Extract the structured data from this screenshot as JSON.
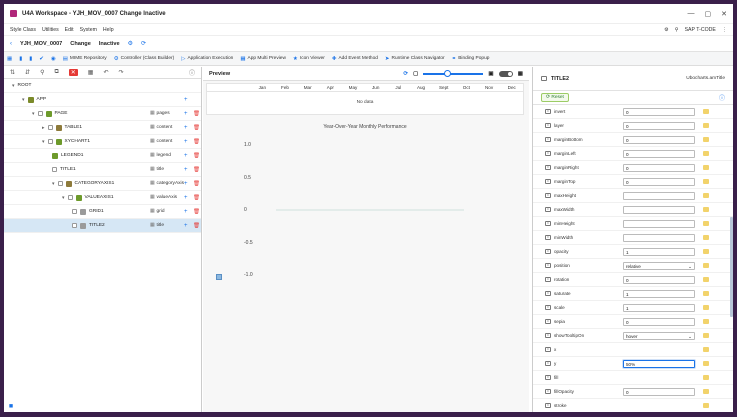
{
  "window": {
    "title": "U4A Workspace - YJH_MOV_0007 Change Inactive",
    "minimize": "—",
    "maximize": "▢",
    "close": "✕"
  },
  "menu": {
    "items": [
      "Style Class",
      "Utilities",
      "Edit",
      "System",
      "Help"
    ],
    "sap_code": "SAP T-CODE"
  },
  "header": {
    "program": "YJH_MOV_0007",
    "mode": "Change",
    "status": "Inactive"
  },
  "toolbar": {
    "items": [
      "MIME Repository",
      "Controller (Class Builder)",
      "Application Execution",
      "App Multi Preview",
      "Icon Viewer",
      "Add Event Method",
      "Runtime Class Navigator",
      "Binding Popup"
    ]
  },
  "tree": {
    "rows": [
      {
        "name": "ROOT",
        "type": "",
        "indent": 0,
        "arrow": "▾",
        "color": "",
        "check": false,
        "selected": false
      },
      {
        "name": "APP",
        "type": "",
        "indent": 1,
        "arrow": "▾",
        "color": "#7b8a2a",
        "check": false,
        "selected": false
      },
      {
        "name": "PAGE",
        "type": "pages",
        "indent": 2,
        "arrow": "▾",
        "color": "#6d9a2b",
        "check": true,
        "selected": false
      },
      {
        "name": "TABLE1",
        "type": "content",
        "indent": 3,
        "arrow": "▸",
        "color": "#8d7a3a",
        "check": true,
        "selected": false
      },
      {
        "name": "XYCHART1",
        "type": "content",
        "indent": 3,
        "arrow": "▾",
        "color": "#6d9a2b",
        "check": true,
        "selected": false
      },
      {
        "name": "LEGEND1",
        "type": "legend",
        "indent": 4,
        "arrow": "",
        "color": "#6d9a2b",
        "check": false,
        "selected": false
      },
      {
        "name": "TITLE1",
        "type": "title",
        "indent": 4,
        "arrow": "",
        "color": "",
        "check": true,
        "selected": false
      },
      {
        "name": "CATEGORYAXIS1",
        "type": "categoryAxis",
        "indent": 4,
        "arrow": "▾",
        "color": "#8d7a3a",
        "check": true,
        "selected": false
      },
      {
        "name": "VALUEAXIS1",
        "type": "valueAxis",
        "indent": 5,
        "arrow": "▾",
        "color": "#6d9a2b",
        "check": true,
        "selected": false
      },
      {
        "name": "GRID1",
        "type": "grid",
        "indent": 6,
        "arrow": "",
        "color": "#9a9a9a",
        "check": true,
        "selected": false
      },
      {
        "name": "TITLE2",
        "type": "title",
        "indent": 6,
        "arrow": "",
        "color": "#9a9a9a",
        "check": true,
        "selected": true
      }
    ]
  },
  "preview": {
    "title": "Preview",
    "months": [
      "Jan",
      "Feb",
      "Mar",
      "Apr",
      "May",
      "Jun",
      "Jul",
      "Aug",
      "Sept",
      "Oct",
      "Nov",
      "Dec"
    ],
    "no_data": "No data",
    "zoom_level": 0.4
  },
  "chart_data": {
    "type": "line",
    "title": "Year-Over-Year Monthly Performance",
    "series": [],
    "ylim": [
      -1.0,
      1.0
    ],
    "yticks": [
      "1.0",
      "0.5",
      "0",
      "-0.5",
      "-1.0"
    ],
    "xlabel": "",
    "ylabel": ""
  },
  "props": {
    "element": "TITLE2",
    "path": "Ubocharts.amTitle",
    "reset_label": "Reset",
    "rows": [
      {
        "name": "invert",
        "value": "0",
        "kind": "input"
      },
      {
        "name": "layer",
        "value": "0",
        "kind": "input"
      },
      {
        "name": "marginBottom",
        "value": "0",
        "kind": "input"
      },
      {
        "name": "marginLeft",
        "value": "0",
        "kind": "input"
      },
      {
        "name": "marginRight",
        "value": "0",
        "kind": "input"
      },
      {
        "name": "marginTop",
        "value": "0",
        "kind": "input"
      },
      {
        "name": "maxHeight",
        "value": "",
        "kind": "input"
      },
      {
        "name": "maxWidth",
        "value": "",
        "kind": "input"
      },
      {
        "name": "minHeight",
        "value": "",
        "kind": "input"
      },
      {
        "name": "minWidth",
        "value": "",
        "kind": "input"
      },
      {
        "name": "opacity",
        "value": "1",
        "kind": "input"
      },
      {
        "name": "position",
        "value": "relative",
        "kind": "select"
      },
      {
        "name": "rotation",
        "value": "0",
        "kind": "input"
      },
      {
        "name": "saturate",
        "value": "1",
        "kind": "input"
      },
      {
        "name": "scale",
        "value": "1",
        "kind": "input"
      },
      {
        "name": "sepia",
        "value": "0",
        "kind": "input"
      },
      {
        "name": "showTooltipOn",
        "value": "hover",
        "kind": "select"
      },
      {
        "name": "x",
        "value": "",
        "kind": "none"
      },
      {
        "name": "y",
        "value": "50%",
        "kind": "focus"
      },
      {
        "name": "fill",
        "value": "",
        "kind": "none"
      },
      {
        "name": "fillOpacity",
        "value": "0",
        "kind": "input"
      },
      {
        "name": "stroke",
        "value": "",
        "kind": "none"
      }
    ]
  }
}
